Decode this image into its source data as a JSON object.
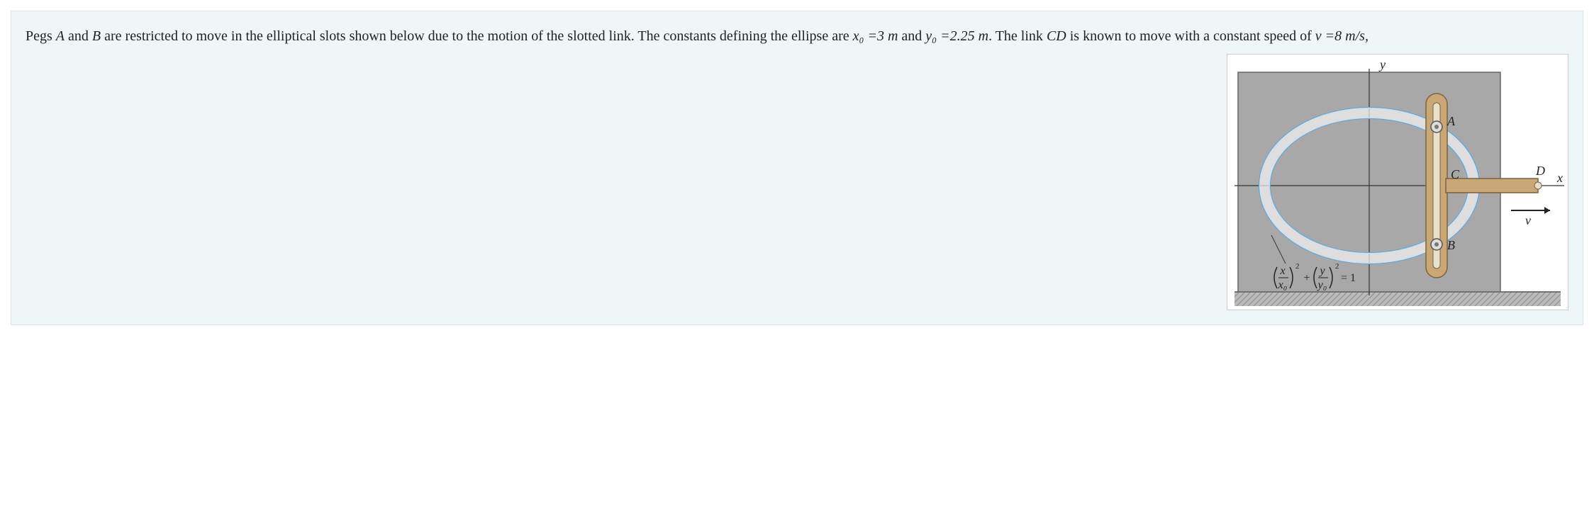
{
  "problem": {
    "text_1": "Pegs ",
    "var_A": "A",
    "text_2": " and ",
    "var_B": "B",
    "text_3": " are restricted to move in the elliptical slots shown below due to the motion of the slotted link. The constants defining the ellipse are ",
    "eq_x0": "x₀ =3 m",
    "text_4": " and ",
    "eq_y0": "y₀ =2.25 m",
    "text_5": ".   The link ",
    "var_CD": "CD",
    "text_6": " is known to move with a constant speed of ",
    "eq_v": "v =8 m/s,",
    "text_7": ""
  },
  "diagram": {
    "label_y": "y",
    "label_x": "x",
    "label_A": "A",
    "label_B": "B",
    "label_C": "C",
    "label_D": "D",
    "label_v": "v",
    "formula_x": "x",
    "formula_x0": "x₀",
    "formula_y": "y",
    "formula_y0": "y₀",
    "formula_eq1": " = 1",
    "formula_plus": "+",
    "formula_exp": "2"
  },
  "constants": {
    "x0_m": 3,
    "y0_m": 2.25,
    "v_mps": 8
  }
}
